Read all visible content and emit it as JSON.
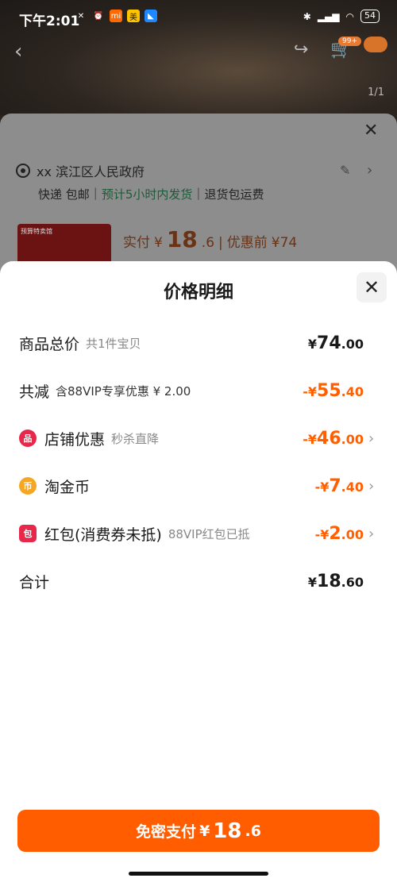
{
  "status_bar": {
    "time": "下午2:01",
    "battery": "54",
    "icons": [
      "mute-icon",
      "alarm-icon",
      "mi-icon",
      "meituan-icon",
      "app-icon",
      "bluetooth-icon",
      "signal-icon",
      "wifi-icon"
    ]
  },
  "top_nav": {
    "cart_badge": "99+",
    "page_indicator": "1/1"
  },
  "sku_sheet": {
    "address": "xx 滨江区人民政府",
    "shipping": {
      "express": "快递 包邮",
      "sep1": "|",
      "dispatch": "预计5小时内发货",
      "sep2": "|",
      "returns": "退货包运费"
    },
    "thumb_text": "预算特卖馆",
    "price": {
      "paid_label": "实付",
      "currency": "¥",
      "int": "18",
      "dec": ".6",
      "sep": "|",
      "before_label": "优惠前",
      "before_value": "¥74"
    }
  },
  "price_detail": {
    "title": "价格明细",
    "rows": [
      {
        "label": "商品总价",
        "sub": "共1件宝贝",
        "currency": "¥",
        "int": "74",
        "dec": ".00"
      },
      {
        "label": "共减",
        "sub": "含88VIP专享优惠 ¥ 2.00",
        "currency": "-¥",
        "int": "55",
        "dec": ".40"
      },
      {
        "label": "店铺优惠",
        "sub": "秒杀直降",
        "currency": "-¥",
        "int": "46",
        "dec": ".00",
        "icon": "store-icon",
        "icon_color": "#e8284a",
        "icon_glyph": "品"
      },
      {
        "label": "淘金币",
        "sub": "",
        "currency": "-¥",
        "int": "7",
        "dec": ".40",
        "icon": "coin-icon",
        "icon_color": "#f5a623",
        "icon_glyph": "币"
      },
      {
        "label": "红包(消费券未抵)",
        "sub": "88VIP红包已抵",
        "currency": "-¥",
        "int": "2",
        "dec": ".00",
        "icon": "red-packet-icon",
        "icon_color": "#e8284a",
        "icon_glyph": "包"
      },
      {
        "label": "合计",
        "sub": "",
        "currency": "¥",
        "int": "18",
        "dec": ".60"
      }
    ],
    "chevron": "›"
  },
  "pay_button": {
    "label": "免密支付",
    "currency": "¥",
    "int": "18",
    "dec": ".6"
  },
  "colors": {
    "accent": "#ff5d00",
    "discount": "#ff5f00"
  }
}
